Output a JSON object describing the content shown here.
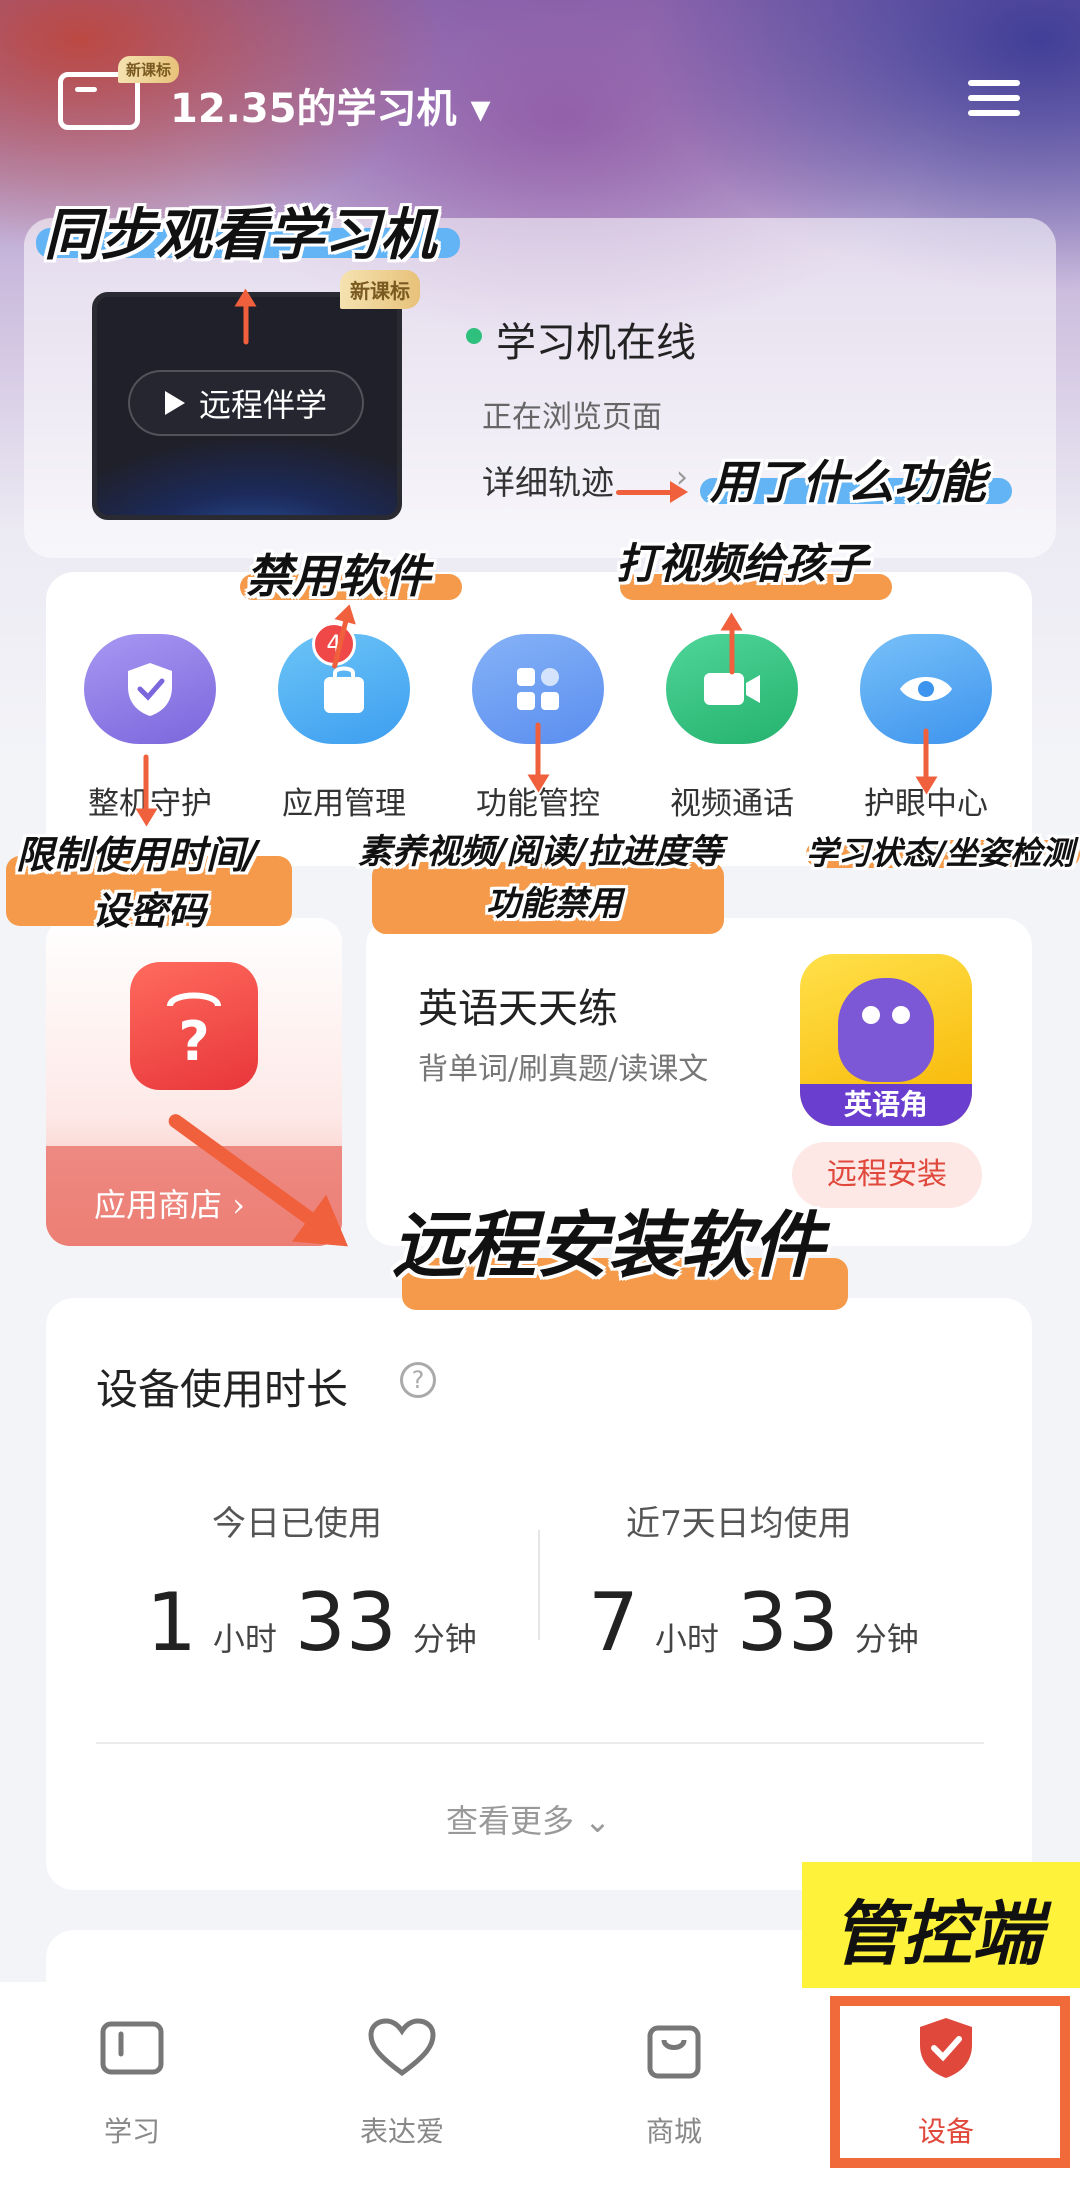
{
  "header": {
    "device_tag": "新课标",
    "device_title": "12.35的学习机 ▾"
  },
  "status_card": {
    "tablet_tag": "新课标",
    "companion_button": "远程伴学",
    "online_status": "学习机在线",
    "activity_text": "正在浏览页面",
    "track_link": "详细轨迹",
    "track_chevron": "›"
  },
  "features": [
    {
      "label": "整机守护",
      "icon": "shield-check-icon",
      "color": "#8f7de6"
    },
    {
      "label": "应用管理",
      "icon": "shopping-bag-icon",
      "color": "#4aaef0",
      "badge": "4"
    },
    {
      "label": "功能管控",
      "icon": "grid-icon",
      "color": "#5c96f0"
    },
    {
      "label": "视频通话",
      "icon": "video-camera-icon",
      "color": "#2fc07d"
    },
    {
      "label": "护眼中心",
      "icon": "eye-icon",
      "color": "#4aa0f0"
    }
  ],
  "store": {
    "label": "应用商店 ›"
  },
  "english": {
    "title": "英语天天练",
    "subtitle": "背单词/刷真题/读课文",
    "app_label": "英语角",
    "install_button": "远程安装"
  },
  "usage": {
    "title": "设备使用时长",
    "help": "?",
    "today_label": "今日已使用",
    "today_hours": "1",
    "today_minutes": "33",
    "avg_label": "近7天日均使用",
    "avg_hours": "7",
    "avg_minutes": "33",
    "hour_unit": "小时",
    "minute_unit": "分钟",
    "see_more": "查看更多 ⌄"
  },
  "nav": [
    {
      "label": "学习",
      "icon": "book-icon"
    },
    {
      "label": "表达爱",
      "icon": "heart-icon"
    },
    {
      "label": "商城",
      "icon": "shopping-bag-icon"
    },
    {
      "label": "设备",
      "icon": "shield-check-icon",
      "active": true
    }
  ],
  "annotations": {
    "sync_watch": "同步观看学习机",
    "what_functions": "用了什么功能",
    "disable_apps": "禁用软件",
    "video_call_child": "打视频给孩子",
    "limit_time_1": "限制使用时间/",
    "limit_time_2": "设密码",
    "content_disable_1": "素养视频/阅读/拉进度等",
    "content_disable_2": "功能禁用",
    "study_state": "学习状态/坐姿检测",
    "remote_install": "远程安装软件",
    "control_side": "管控端"
  },
  "colors": {
    "accent_red": "#e0483c",
    "online_green": "#2fc07d",
    "annotation_orange": "#f59a4a",
    "annotation_blue": "#63b4f4",
    "highlight_yellow": "#fff23a"
  }
}
